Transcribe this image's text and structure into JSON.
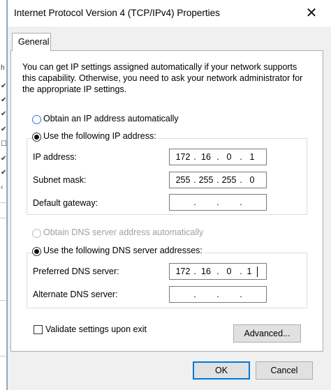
{
  "window": {
    "title": "Internet Protocol Version 4 (TCP/IPv4) Properties"
  },
  "tabs": [
    {
      "label": "General"
    }
  ],
  "description": "You can get IP settings assigned automatically if your network supports this capability. Otherwise, you need to ask your network administrator for the appropriate IP settings.",
  "ip_section": {
    "auto_label": "Obtain an IP address automatically",
    "manual_label": "Use the following IP address:",
    "selected": "manual",
    "fields": [
      {
        "label": "IP address:",
        "octets": [
          "172",
          "16",
          "0",
          "1"
        ]
      },
      {
        "label": "Subnet mask:",
        "octets": [
          "255",
          "255",
          "255",
          "0"
        ]
      },
      {
        "label": "Default gateway:",
        "octets": [
          "",
          "",
          "",
          ""
        ]
      }
    ]
  },
  "dns_section": {
    "auto_label": "Obtain DNS server address automatically",
    "manual_label": "Use the following DNS server addresses:",
    "selected": "manual",
    "fields": [
      {
        "label": "Preferred DNS server:",
        "octets": [
          "172",
          "16",
          "0",
          "1"
        ]
      },
      {
        "label": "Alternate DNS server:",
        "octets": [
          "",
          "",
          "",
          ""
        ]
      }
    ]
  },
  "validate_label": "Validate settings upon exit",
  "validate_checked": false,
  "buttons": {
    "advanced": "Advanced...",
    "ok": "OK",
    "cancel": "Cancel"
  },
  "icons": {
    "close": "close-icon"
  }
}
